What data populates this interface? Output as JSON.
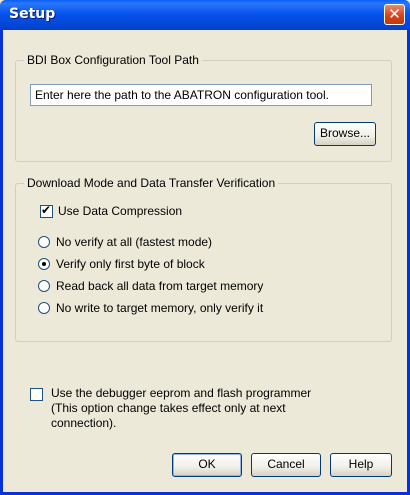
{
  "window": {
    "title": "Setup",
    "close_glyph": "✕"
  },
  "tool_path": {
    "legend": "BDI Box Configuration Tool Path",
    "input_value": "Enter here the path to the ABATRON configuration tool.",
    "browse_label": "Browse..."
  },
  "download": {
    "legend": "Download Mode and Data Transfer Verification",
    "compression_label": "Use Data Compression",
    "compression_checked": true,
    "options": [
      {
        "label": "No verify at all (fastest mode)",
        "selected": false
      },
      {
        "label": "Verify only first byte of block",
        "selected": true
      },
      {
        "label": "Read back all data from target memory",
        "selected": false
      },
      {
        "label": "No write to target memory, only verify it",
        "selected": false
      }
    ]
  },
  "eeprom": {
    "line1": "Use the debugger eeprom and flash programmer",
    "line2": "(This option change takes effect only at next",
    "line3": "connection).",
    "checked": false
  },
  "buttons": {
    "ok": "OK",
    "cancel": "Cancel",
    "help": "Help"
  },
  "colors": {
    "titlebar": "#0753ee",
    "face": "#ece9d8",
    "close": "#d8431b"
  }
}
